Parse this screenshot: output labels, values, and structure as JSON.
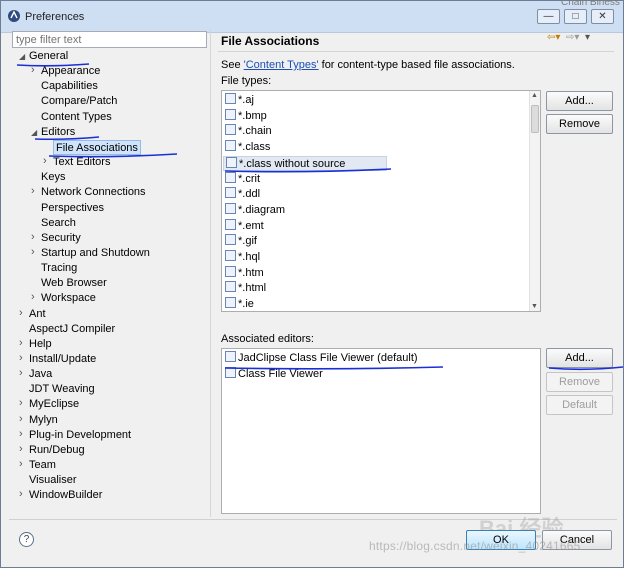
{
  "window": {
    "title": "Preferences",
    "background_text": "Chain Biness",
    "buttons": {
      "minimize": "—",
      "maximize": "□",
      "close": "✕"
    }
  },
  "filter": {
    "placeholder": "type filter text"
  },
  "tree": [
    {
      "label": "General",
      "depth": 0,
      "twisty": "expanded"
    },
    {
      "label": "Appearance",
      "depth": 1,
      "twisty": "collapsed"
    },
    {
      "label": "Capabilities",
      "depth": 1,
      "twisty": "none"
    },
    {
      "label": "Compare/Patch",
      "depth": 1,
      "twisty": "none"
    },
    {
      "label": "Content Types",
      "depth": 1,
      "twisty": "none"
    },
    {
      "label": "Editors",
      "depth": 1,
      "twisty": "expanded"
    },
    {
      "label": "File Associations",
      "depth": 2,
      "twisty": "none",
      "selected": true
    },
    {
      "label": "Text Editors",
      "depth": 2,
      "twisty": "collapsed"
    },
    {
      "label": "Keys",
      "depth": 1,
      "twisty": "none"
    },
    {
      "label": "Network Connections",
      "depth": 1,
      "twisty": "collapsed"
    },
    {
      "label": "Perspectives",
      "depth": 1,
      "twisty": "none"
    },
    {
      "label": "Search",
      "depth": 1,
      "twisty": "none"
    },
    {
      "label": "Security",
      "depth": 1,
      "twisty": "collapsed"
    },
    {
      "label": "Startup and Shutdown",
      "depth": 1,
      "twisty": "collapsed"
    },
    {
      "label": "Tracing",
      "depth": 1,
      "twisty": "none"
    },
    {
      "label": "Web Browser",
      "depth": 1,
      "twisty": "none"
    },
    {
      "label": "Workspace",
      "depth": 1,
      "twisty": "collapsed"
    },
    {
      "label": "Ant",
      "depth": 0,
      "twisty": "collapsed"
    },
    {
      "label": "AspectJ Compiler",
      "depth": 0,
      "twisty": "none"
    },
    {
      "label": "Help",
      "depth": 0,
      "twisty": "collapsed"
    },
    {
      "label": "Install/Update",
      "depth": 0,
      "twisty": "collapsed"
    },
    {
      "label": "Java",
      "depth": 0,
      "twisty": "collapsed"
    },
    {
      "label": "JDT Weaving",
      "depth": 0,
      "twisty": "none"
    },
    {
      "label": "MyEclipse",
      "depth": 0,
      "twisty": "collapsed"
    },
    {
      "label": "Mylyn",
      "depth": 0,
      "twisty": "collapsed"
    },
    {
      "label": "Plug-in Development",
      "depth": 0,
      "twisty": "collapsed"
    },
    {
      "label": "Run/Debug",
      "depth": 0,
      "twisty": "collapsed"
    },
    {
      "label": "Team",
      "depth": 0,
      "twisty": "collapsed"
    },
    {
      "label": "Visualiser",
      "depth": 0,
      "twisty": "none"
    },
    {
      "label": "WindowBuilder",
      "depth": 0,
      "twisty": "collapsed"
    }
  ],
  "page": {
    "title": "File Associations",
    "see_prefix": "See ",
    "see_link": "'Content Types'",
    "see_suffix": " for content-type based file associations.",
    "file_types_label": "File types:",
    "associated_label": "Associated editors:"
  },
  "file_types": [
    "*.aj",
    "*.bmp",
    "*.chain",
    "*.class",
    "*.class without source",
    "*.crit",
    "*.ddl",
    "*.diagram",
    "*.emt",
    "*.gif",
    "*.hql",
    "*.htm",
    "*.html",
    "*.ie"
  ],
  "editors": [
    "JadClipse Class File Viewer (default)",
    "Class File Viewer"
  ],
  "buttons": {
    "add_type": "Add...",
    "remove_type": "Remove",
    "add_editor": "Add...",
    "remove_editor": "Remove",
    "default_editor": "Default",
    "ok": "OK",
    "cancel": "Cancel",
    "help": "?"
  },
  "watermark": {
    "text": "https://blog.csdn.net/weixin_40241665",
    "logo": "Bai 经验"
  },
  "colors": {
    "annotation_ink": "#1a2fd6",
    "link": "#1a4fb5",
    "selection": "#cfe3fb"
  }
}
